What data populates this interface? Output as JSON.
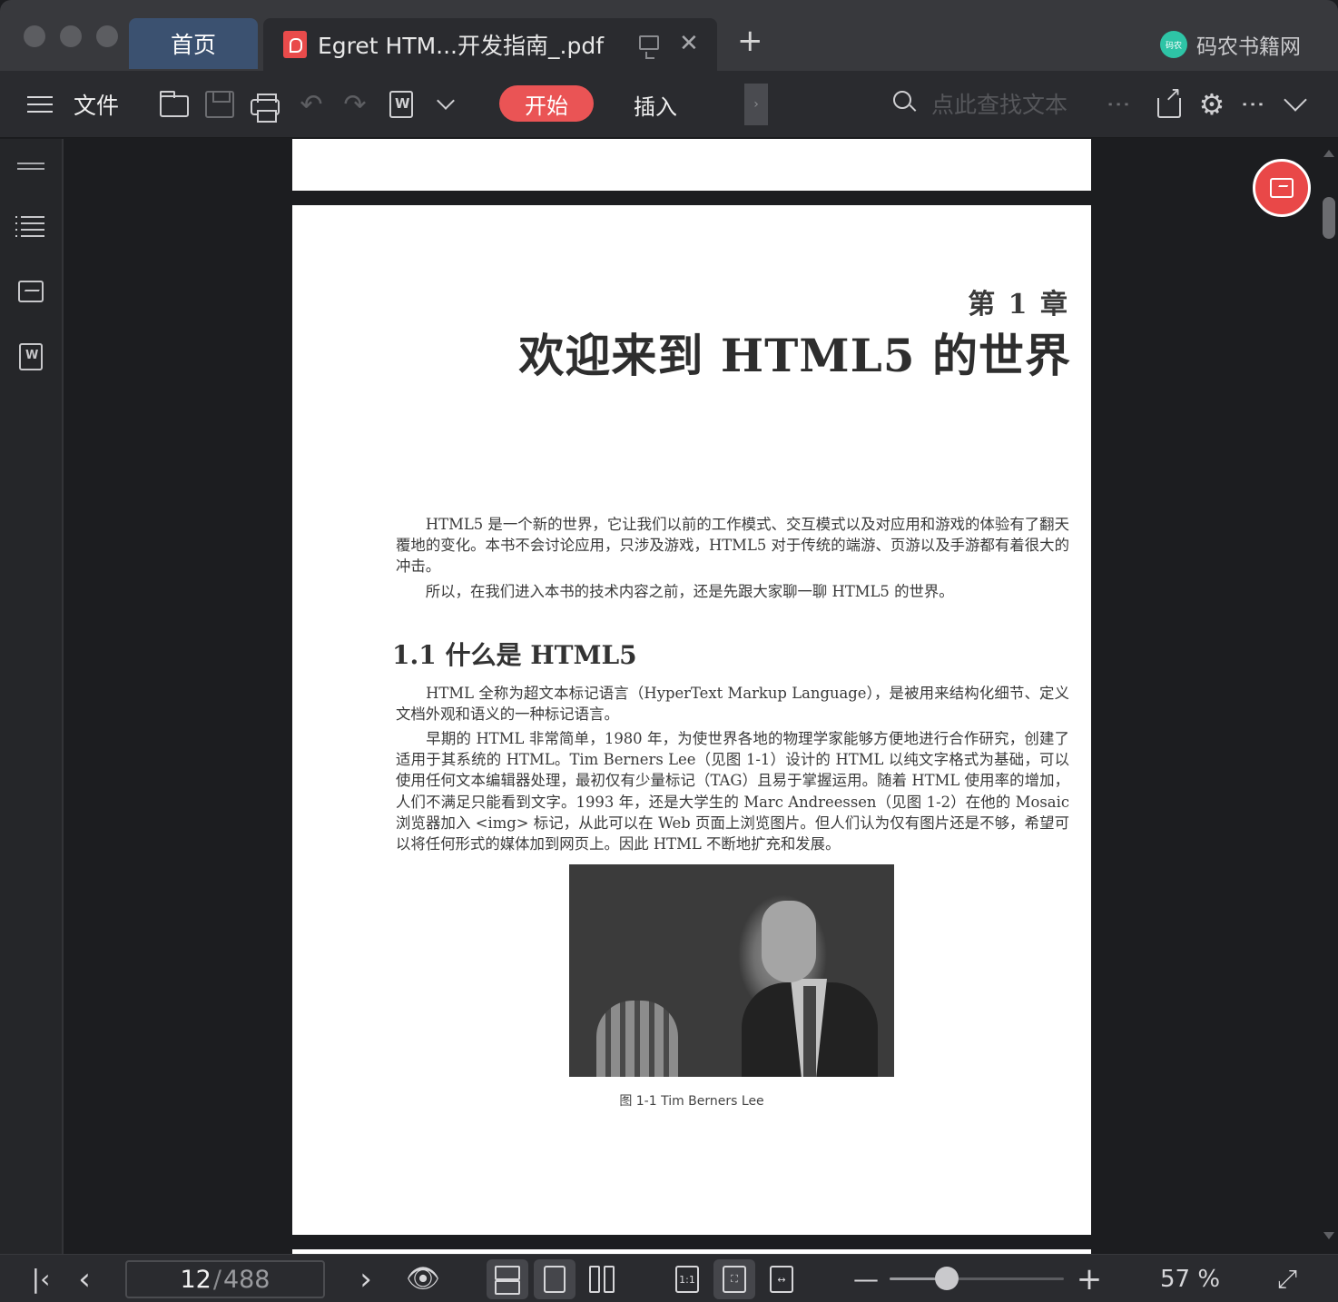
{
  "tabs": {
    "home_label": "首页",
    "document_title": "Egret HTM...开发指南_.pdf",
    "close_glyph": "✕",
    "add_glyph": "+"
  },
  "brand": {
    "logo_text": "码农",
    "name": "码农书籍网",
    "color": "#2ec4a6"
  },
  "toolbar": {
    "file_label": "文件",
    "start_label": "开始",
    "insert_label": "插入",
    "more_glyph": "›",
    "search_placeholder": "点此查找文本",
    "accent_color": "#ea5455",
    "undo_glyph": "↶",
    "redo_glyph": "↷",
    "gear_glyph": "⚙",
    "vdots": "⋮"
  },
  "document": {
    "chapter_number": "第 1 章",
    "chapter_title": "欢迎来到 HTML5 的世界",
    "intro_paragraphs": [
      "　　HTML5 是一个新的世界，它让我们以前的工作模式、交互模式以及对应用和游戏的体验有了翻天覆地的变化。本书不会讨论应用，只涉及游戏，HTML5 对于传统的端游、页游以及手游都有着很大的冲击。",
      "　　所以，在我们进入本书的技术内容之前，还是先跟大家聊一聊 HTML5 的世界。"
    ],
    "section_title": "1.1 什么是 HTML5",
    "section_paragraphs": [
      "　　HTML 全称为超文本标记语言（HyperText Markup Language），是被用来结构化细节、定义文档外观和语义的一种标记语言。",
      "　　早期的 HTML 非常简单，1980 年，为使世界各地的物理学家能够方便地进行合作研究，创建了适用于其系统的 HTML。Tim Berners Lee（见图 1-1）设计的 HTML 以纯文字格式为基础，可以使用任何文本编辑器处理，最初仅有少量标记（TAG）且易于掌握运用。随着 HTML 使用率的增加，人们不满足只能看到文字。1993 年，还是大学生的 Marc Andreessen（见图 1-2）在他的 Mosaic 浏览器加入 <img> 标记，从此可以在 Web 页面上浏览图片。但人们认为仅有图片还是不够，希望可以将任何形式的媒体加到网页上。因此 HTML 不断地扩充和发展。"
    ],
    "figure_caption": "图 1-1  Tim Berners Lee"
  },
  "statusbar": {
    "current_page": "12",
    "page_separator": "/",
    "total_pages": "488",
    "first_glyph": "|‹",
    "prev_glyph": "‹",
    "next_glyph": "›",
    "minus_glyph": "—",
    "plus_glyph": "+",
    "fit_label": "1:1",
    "zoom_percent": 57,
    "zoom_text": "57 %",
    "zoom_slider_fraction": 0.33
  }
}
